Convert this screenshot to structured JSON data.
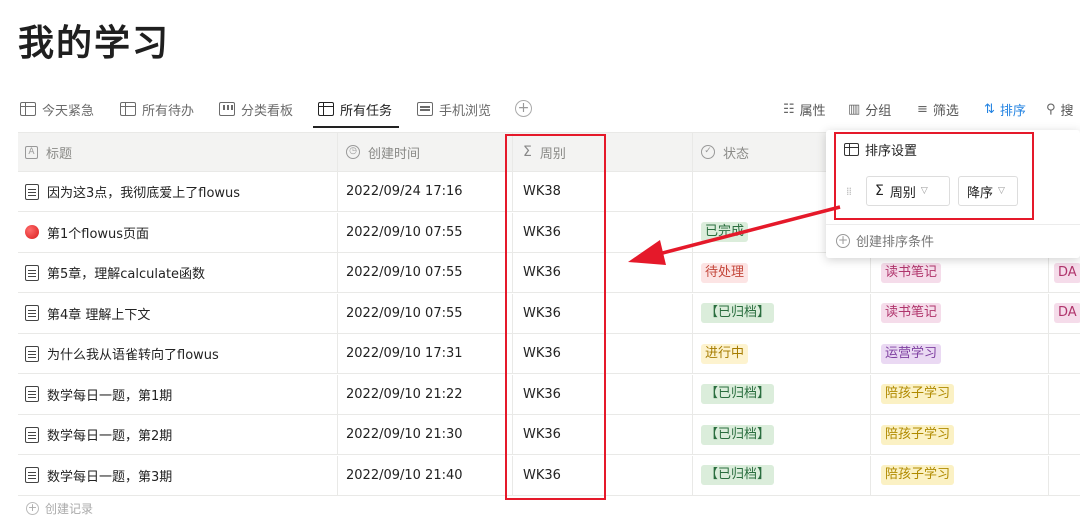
{
  "page": {
    "title": "我的学习"
  },
  "views": [
    {
      "label": "今天紧急",
      "icon": "table-icon"
    },
    {
      "label": "所有待办",
      "icon": "table-icon"
    },
    {
      "label": "分类看板",
      "icon": "board-icon"
    },
    {
      "label": "所有任务",
      "icon": "table-icon",
      "active": true
    },
    {
      "label": "手机浏览",
      "icon": "form-icon"
    }
  ],
  "toolbar": {
    "properties": "属性",
    "group": "分组",
    "filter": "筛选",
    "sort": "排序",
    "search": "搜"
  },
  "columns": {
    "title": "标题",
    "created": "创建时间",
    "week": "周别",
    "status": "状态"
  },
  "rows": [
    {
      "title": "因为这3点，我彻底爱上了flowus",
      "created": "2022/09/24 17:16",
      "week": "WK38",
      "status": "",
      "category": "",
      "extra": "",
      "icon": "doc-icon"
    },
    {
      "title": "第1个flowus页面",
      "created": "2022/09/10 07:55",
      "week": "WK36",
      "status": "已完成",
      "category": "",
      "extra": "",
      "icon": "red-dot-icon"
    },
    {
      "title": "第5章，理解calculate函数",
      "created": "2022/09/10 07:55",
      "week": "WK36",
      "status": "待处理",
      "category": "读书笔记",
      "extra": "DA",
      "icon": "doc-icon"
    },
    {
      "title": "第4章 理解上下文",
      "created": "2022/09/10 07:55",
      "week": "WK36",
      "status": "【已归档】",
      "category": "读书笔记",
      "extra": "DA",
      "icon": "doc-icon"
    },
    {
      "title": "为什么我从语雀转向了flowus",
      "created": "2022/09/10 17:31",
      "week": "WK36",
      "status": "进行中",
      "category": "运营学习",
      "extra": "",
      "icon": "doc-icon"
    },
    {
      "title": "数学每日一题，第1期",
      "created": "2022/09/10 21:22",
      "week": "WK36",
      "status": "【已归档】",
      "category": "陪孩子学习",
      "extra": "",
      "icon": "doc-icon"
    },
    {
      "title": "数学每日一题，第2期",
      "created": "2022/09/10 21:30",
      "week": "WK36",
      "status": "【已归档】",
      "category": "陪孩子学习",
      "extra": "",
      "icon": "doc-icon"
    },
    {
      "title": "数学每日一题，第3期",
      "created": "2022/09/10 21:40",
      "week": "WK36",
      "status": "【已归档】",
      "category": "陪孩子学习",
      "extra": "",
      "icon": "doc-icon"
    }
  ],
  "create_record": "创建记录",
  "sort_popup": {
    "title": "排序设置",
    "field": "周别",
    "order": "降序",
    "add_condition": "创建排序条件"
  },
  "colors": {
    "annotation_red": "#e5192a",
    "accent_blue": "#2383e2"
  }
}
